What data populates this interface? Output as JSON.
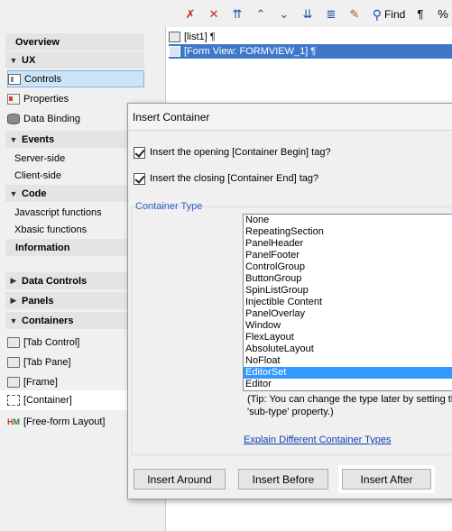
{
  "toolbar": {
    "buttons": [
      {
        "icon": "delete-multiple-icon",
        "glyph": "✗"
      },
      {
        "icon": "delete-icon",
        "glyph": "✕"
      },
      {
        "icon": "move-top-icon",
        "glyph": "⇈"
      },
      {
        "icon": "move-up-icon",
        "glyph": "^"
      },
      {
        "icon": "move-down-icon",
        "glyph": "ˇ"
      },
      {
        "icon": "move-bottom-icon",
        "glyph": "⇊"
      },
      {
        "icon": "indent-icon",
        "glyph": "≣"
      },
      {
        "icon": "wand-icon",
        "glyph": "✎"
      },
      {
        "icon": "find-icon",
        "glyph": "⚲"
      },
      {
        "icon": "pilcrow-icon",
        "glyph": "¶"
      },
      {
        "icon": "percent-icon",
        "glyph": "%"
      }
    ],
    "find_label": "Find",
    "pilcrow": "¶",
    "percent": "%"
  },
  "sidebar": {
    "overview": "Overview",
    "ux": "UX",
    "controls": "Controls",
    "properties": "Properties",
    "data_binding": "Data Binding",
    "events": "Events",
    "server_side": "Server-side",
    "client_side": "Client-side",
    "code": "Code",
    "js_functions": "Javascript functions",
    "xbasic_functions": "Xbasic functions",
    "information": "Information",
    "data_controls": "Data Controls",
    "panels": "Panels",
    "containers": "Containers",
    "tab_control": "[Tab Control]",
    "tab_pane": "[Tab Pane]",
    "frame": "[Frame]",
    "container": "[Container]",
    "freeform": "[Free-form Layout]"
  },
  "tree": {
    "list1": "[list1] ¶",
    "formview": "[Form View: FORMVIEW_1] ¶"
  },
  "dialog": {
    "title": "Insert Container",
    "chk_begin": "Insert the opening [Container Begin] tag?",
    "chk_end": "Insert the closing [Container End] tag?",
    "group_label": "Container Type",
    "options": [
      "None",
      "RepeatingSection",
      "PanelHeader",
      "PanelFooter",
      "ControlGroup",
      "ButtonGroup",
      "SpinListGroup",
      "Injectible Content",
      "PanelOverlay",
      "Window",
      "FlexLayout",
      "AbsoluteLayout",
      "NoFloat",
      "EditorSet",
      "Editor"
    ],
    "selected_option": "EditorSet",
    "tip_line1": "(Tip: You can change the type later  by setting the",
    "tip_line2": "'sub-type' property.)",
    "link": "Explain Different Container Types",
    "btn_around": "Insert Around",
    "btn_before": "Insert Before",
    "btn_after": "Insert After"
  }
}
